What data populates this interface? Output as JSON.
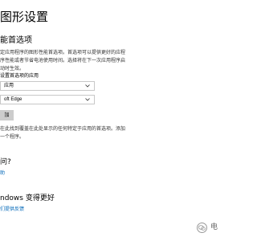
{
  "page": {
    "title": "图形设置"
  },
  "prefs": {
    "section_title": "能首选项",
    "description": "定应用程序的图形性能首选项。首选项可以提供更好的应程序性能或者节省电池使用时间。选择将在下一次应用程序启动时生效。",
    "app_label": "设置首选项的应用",
    "app_type_value": "应用",
    "app_value": "oft Edge",
    "add_button_label": "加",
    "help_text": "在此找到覆盖在此处显示的任何特定于应用的首选项。添加一个程序。"
  },
  "help": {
    "question": "问?",
    "link_text": "助"
  },
  "improve": {
    "title": "ndows 变得更好",
    "link_text": "们提供反馈"
  },
  "watermark": {
    "text": "电"
  },
  "colors": {
    "link": "#0067b8",
    "button_bg": "#cccccc",
    "select_border": "#c8c8c8"
  }
}
